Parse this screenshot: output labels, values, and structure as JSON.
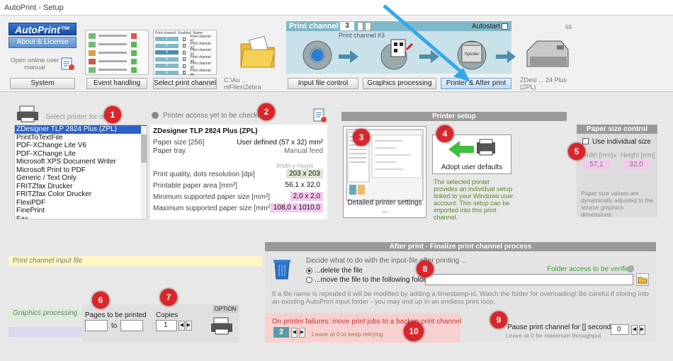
{
  "window": {
    "title": "AutoPrint - Setup"
  },
  "top": {
    "logo": "AutoPrint™",
    "about_label": "About & License",
    "online_manual": "Open online user manual",
    "system_label": "System",
    "event_label": "Event handling",
    "select_channel_label": "Select print channel",
    "path_label": "C:\\Au ... ntFiles\\Zebra",
    "printer_short": "ZDesi ... 24 Plus (ZPL)",
    "number_59": "59"
  },
  "channel": {
    "header": "Print channel",
    "number": "3",
    "subtitle": "Print channel #3",
    "autostart": "Autostart",
    "step1": "Input file control",
    "step2": "Graphics processing",
    "step3": "Printer & After print"
  },
  "channel_table": {
    "headers": [
      "Print channel",
      "Enabled",
      "Name"
    ],
    "rows": [
      {
        "num": "1",
        "name": "Print channel #1"
      },
      {
        "num": "2",
        "name": "Print channel #2"
      },
      {
        "num": "3",
        "name": "Print channel #3"
      },
      {
        "num": "4",
        "name": "Print channel #4"
      },
      {
        "num": "5",
        "name": "Print channel #5"
      },
      {
        "num": "6",
        "name": "Print channel #6"
      }
    ]
  },
  "printer_select": {
    "label": "Select printer for output",
    "items": [
      "ZDesigner TLP 2824 Plus (ZPL)",
      "PrintToTextFile",
      "PDF-XChange Lite V6",
      "PDF-XChange Lite",
      "Microsoft XPS Document Writer",
      "Microsoft Print to PDF",
      "Generic / Text Only",
      "FRITZfax Drucker",
      "FRITZfax Color Drucker",
      "FlexiPDF",
      "FinePrint",
      "Fax"
    ]
  },
  "printer_info": {
    "access": "Printer access yet to be checked",
    "name": "ZDesigner TLP 2824 Plus (ZPL)",
    "paper_size_label": "Paper size [256]",
    "paper_size_value": "User defined (57 x 32) mm²",
    "paper_tray_label": "Paper tray",
    "paper_tray_value": "Manual feed",
    "wh_label": "Width x Height",
    "quality_label": "Print quality, dots resolution [dpi]",
    "quality_value": "203 x 203",
    "area_label": "Printable paper area [mm²]",
    "area_value": "56,1 x 32,0",
    "min_label": "Minimum supported paper size [mm²]",
    "min_value": "2,0 x 2,0",
    "max_label": "Maximum supported paper size [mm²]",
    "max_value": "108,0 x 1010,0"
  },
  "printer_setup": {
    "header": "Printer setup",
    "detailed": "Detailed printer settings ...",
    "adopt": "Adopt user defaults",
    "note": "The selected printer provides an individual setup linked to your Windows user account. This setup can be imported into this print channel."
  },
  "paper_size": {
    "header": "Paper size control",
    "individual": "Use individual size",
    "width_label": "Width [mm]",
    "x": "x",
    "height_label": "Height [mm]",
    "width_value": "57,1",
    "height_value": "32,0",
    "note": "Paper size values are dynamically adjusted to the source graphics dimensions."
  },
  "left_labels": {
    "input_file": "Print channel input file",
    "graphics": "Graphics processing"
  },
  "pages": {
    "label": "Pages to be printed",
    "to": "to",
    "copies_label": "Copies",
    "copies_value": "1",
    "option": "OPTION"
  },
  "after_print": {
    "header": "After print - Finalize print channel process",
    "decide": "Decide what to do with the input-file after printing ...",
    "delete": "...delete the file",
    "move": "...move the file to the following folder",
    "folder_access": "Folder access to be verified",
    "warning": "If a file name is repeated it will be modified by adding a timestamp-id. Watch the folder for overloading! Be careful if storing into an existing AutoPrint input folder - you may end up in an endless print loop.",
    "failure": "On printer failures: move print jobs to a backup print channel",
    "backup_value": "2",
    "leave_zero": "Leave at 0 to keep retrying",
    "pause": "Pause print channel for [] seconds",
    "pause_value": "0",
    "pause_note": "Leave at 0 for maximum throughput"
  },
  "markers": [
    "1",
    "2",
    "3",
    "4",
    "5",
    "6",
    "7",
    "8",
    "9",
    "10"
  ]
}
